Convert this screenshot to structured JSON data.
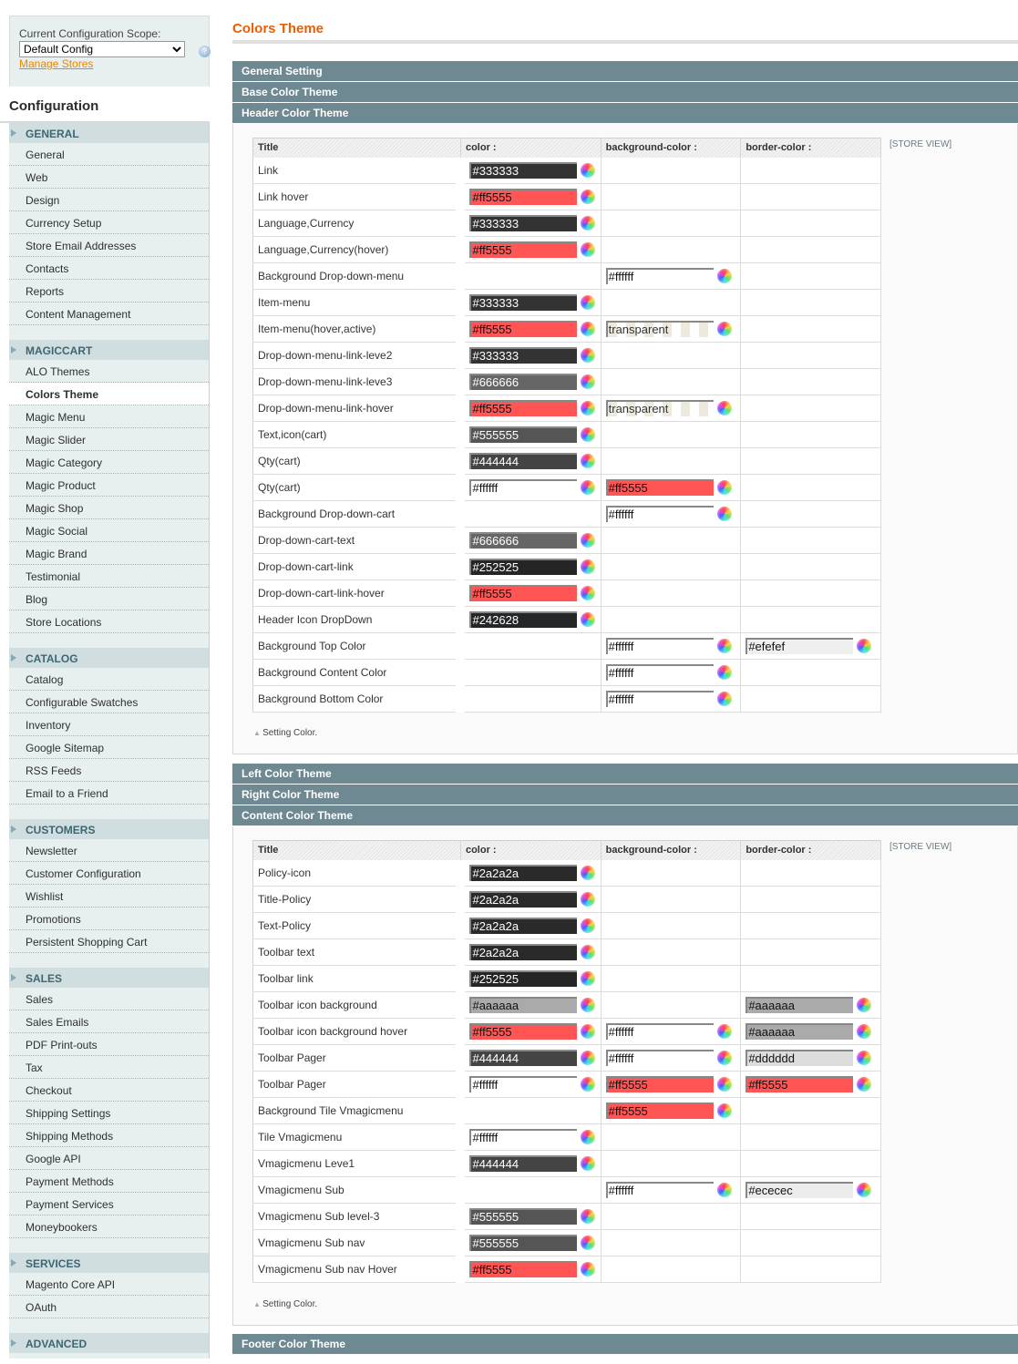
{
  "sidebar": {
    "scope_label": "Current Configuration Scope:",
    "scope_value": "Default Config",
    "manage_stores": "Manage Stores",
    "config_title": "Configuration",
    "groups": [
      {
        "title": "GENERAL",
        "items": [
          "General",
          "Web",
          "Design",
          "Currency Setup",
          "Store Email Addresses",
          "Contacts",
          "Reports",
          "Content Management"
        ]
      },
      {
        "title": "MAGICCART",
        "items": [
          "ALO Themes",
          "Colors Theme",
          "Magic Menu",
          "Magic Slider",
          "Magic Category",
          "Magic Product",
          "Magic Shop",
          "Magic Social",
          "Magic Brand",
          "Testimonial",
          "Blog",
          "Store Locations"
        ]
      },
      {
        "title": "CATALOG",
        "items": [
          "Catalog",
          "Configurable Swatches",
          "Inventory",
          "Google Sitemap",
          "RSS Feeds",
          "Email to a Friend"
        ]
      },
      {
        "title": "CUSTOMERS",
        "items": [
          "Newsletter",
          "Customer Configuration",
          "Wishlist",
          "Promotions",
          "Persistent Shopping Cart"
        ]
      },
      {
        "title": "SALES",
        "items": [
          "Sales",
          "Sales Emails",
          "PDF Print-outs",
          "Tax",
          "Checkout",
          "Shipping Settings",
          "Shipping Methods",
          "Google API",
          "Payment Methods",
          "Payment Services",
          "Moneybookers"
        ]
      },
      {
        "title": "SERVICES",
        "items": [
          "Magento Core API",
          "OAuth"
        ]
      },
      {
        "title": "ADVANCED",
        "items": []
      }
    ],
    "active_item": "Colors Theme"
  },
  "main": {
    "title": "Colors Theme",
    "sections_top": [
      "General Setting",
      "Base Color Theme",
      "Header Color Theme"
    ],
    "sections_mid": [
      "Left Color Theme",
      "Right Color Theme",
      "Content Color Theme"
    ],
    "sections_bottom": [
      "Footer Color Theme"
    ],
    "columns": [
      "Title",
      "color :",
      "background-color :",
      "border-color :"
    ],
    "store_view": "[STORE VIEW]",
    "note": "Setting Color.",
    "header_rows": [
      [
        "Link",
        "#333333",
        null,
        null
      ],
      [
        "Link hover",
        "#ff5555",
        null,
        null
      ],
      [
        "Language,Currency",
        "#333333",
        null,
        null
      ],
      [
        "Language,Currency(hover)",
        "#ff5555",
        null,
        null
      ],
      [
        "Background Drop-down-menu",
        null,
        "#ffffff",
        null
      ],
      [
        "Item-menu",
        "#333333",
        null,
        null
      ],
      [
        "Item-menu(hover,active)",
        "#ff5555",
        "transparent",
        null
      ],
      [
        "Drop-down-menu-link-leve2",
        "#333333",
        null,
        null
      ],
      [
        "Drop-down-menu-link-leve3",
        "#666666",
        null,
        null
      ],
      [
        "Drop-down-menu-link-hover",
        "#ff5555",
        "transparent",
        null
      ],
      [
        "Text,icon(cart)",
        "#555555",
        null,
        null
      ],
      [
        "Qty(cart)",
        "#444444",
        null,
        null
      ],
      [
        "Qty(cart)",
        "#ffffff",
        "#ff5555",
        null
      ],
      [
        "Background Drop-down-cart",
        null,
        "#ffffff",
        null
      ],
      [
        "Drop-down-cart-text",
        "#666666",
        null,
        null
      ],
      [
        "Drop-down-cart-link",
        "#252525",
        null,
        null
      ],
      [
        "Drop-down-cart-link-hover",
        "#ff5555",
        null,
        null
      ],
      [
        "Header Icon DropDown",
        "#242628",
        null,
        null
      ],
      [
        "Background Top Color",
        null,
        "#ffffff",
        "#efefef"
      ],
      [
        "Background Content Color",
        null,
        "#ffffff",
        null
      ],
      [
        "Background Bottom Color",
        null,
        "#ffffff",
        null
      ]
    ],
    "content_rows": [
      [
        "Policy-icon",
        "#2a2a2a",
        null,
        null
      ],
      [
        "Title-Policy",
        "#2a2a2a",
        null,
        null
      ],
      [
        "Text-Policy",
        "#2a2a2a",
        null,
        null
      ],
      [
        "Toolbar text",
        "#2a2a2a",
        null,
        null
      ],
      [
        "Toolbar link",
        "#252525",
        null,
        null
      ],
      [
        "Toolbar icon background",
        "#aaaaaa",
        null,
        "#aaaaaa"
      ],
      [
        "Toolbar icon background hover",
        "#ff5555",
        "#ffffff",
        "#aaaaaa"
      ],
      [
        "Toolbar Pager",
        "#444444",
        "#ffffff",
        "#dddddd"
      ],
      [
        "Toolbar Pager",
        "#ffffff",
        "#ff5555",
        "#ff5555"
      ],
      [
        "Background Tile Vmagicmenu",
        null,
        "#ff5555",
        null
      ],
      [
        "Tile Vmagicmenu",
        "#ffffff",
        null,
        null
      ],
      [
        "Vmagicmenu Leve1",
        "#444444",
        null,
        null
      ],
      [
        "Vmagicmenu Sub",
        null,
        "#ffffff",
        "#ececec"
      ],
      [
        "Vmagicmenu Sub level-3",
        "#555555",
        null,
        null
      ],
      [
        "Vmagicmenu Sub nav",
        "#555555",
        null,
        null
      ],
      [
        "Vmagicmenu Sub nav Hover",
        "#ff5555",
        null,
        null
      ]
    ],
    "icons": {
      "picker": "color-wheel-icon",
      "help": "help-icon"
    }
  }
}
